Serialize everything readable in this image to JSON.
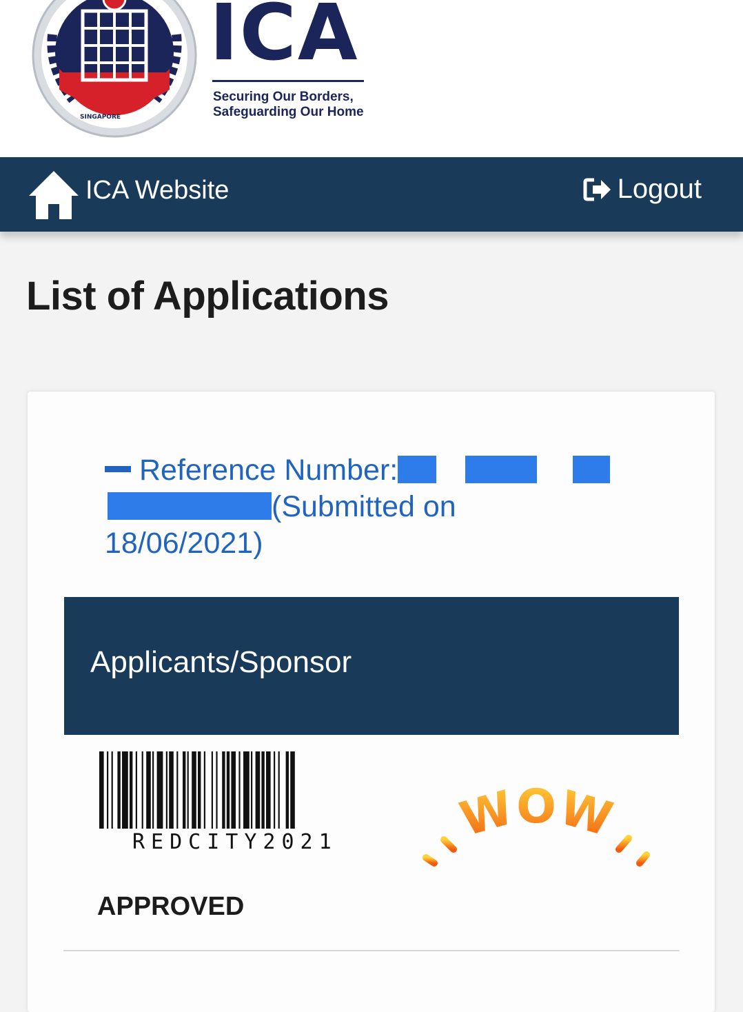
{
  "header": {
    "seal_text": "IMMIGRATION & CHECKPOINTS AUTHORITY SINGAPORE",
    "logo_title": "ICA",
    "tagline_line1": "Securing Our Borders,",
    "tagline_line2": "Safeguarding Our Home"
  },
  "nav": {
    "home_label": "ICA Website",
    "home_icon": "home-icon",
    "logout_label": "Logout",
    "logout_icon": "sign-out-icon"
  },
  "page": {
    "title": "List of Applications"
  },
  "application": {
    "ref_label": "Reference Number:",
    "submitted_prefix": "(Submitted on",
    "submitted_date": "18/06/2021)",
    "section_title": "Applicants/Sponsor",
    "barcode_text": "REDCITY2021",
    "sticker_text": "WOW",
    "status": "APPROVED"
  },
  "colors": {
    "nav_bg": "#1a3a5a",
    "link_blue": "#2164c0",
    "brand_navy": "#1c2559",
    "seal_red": "#d6202a"
  }
}
